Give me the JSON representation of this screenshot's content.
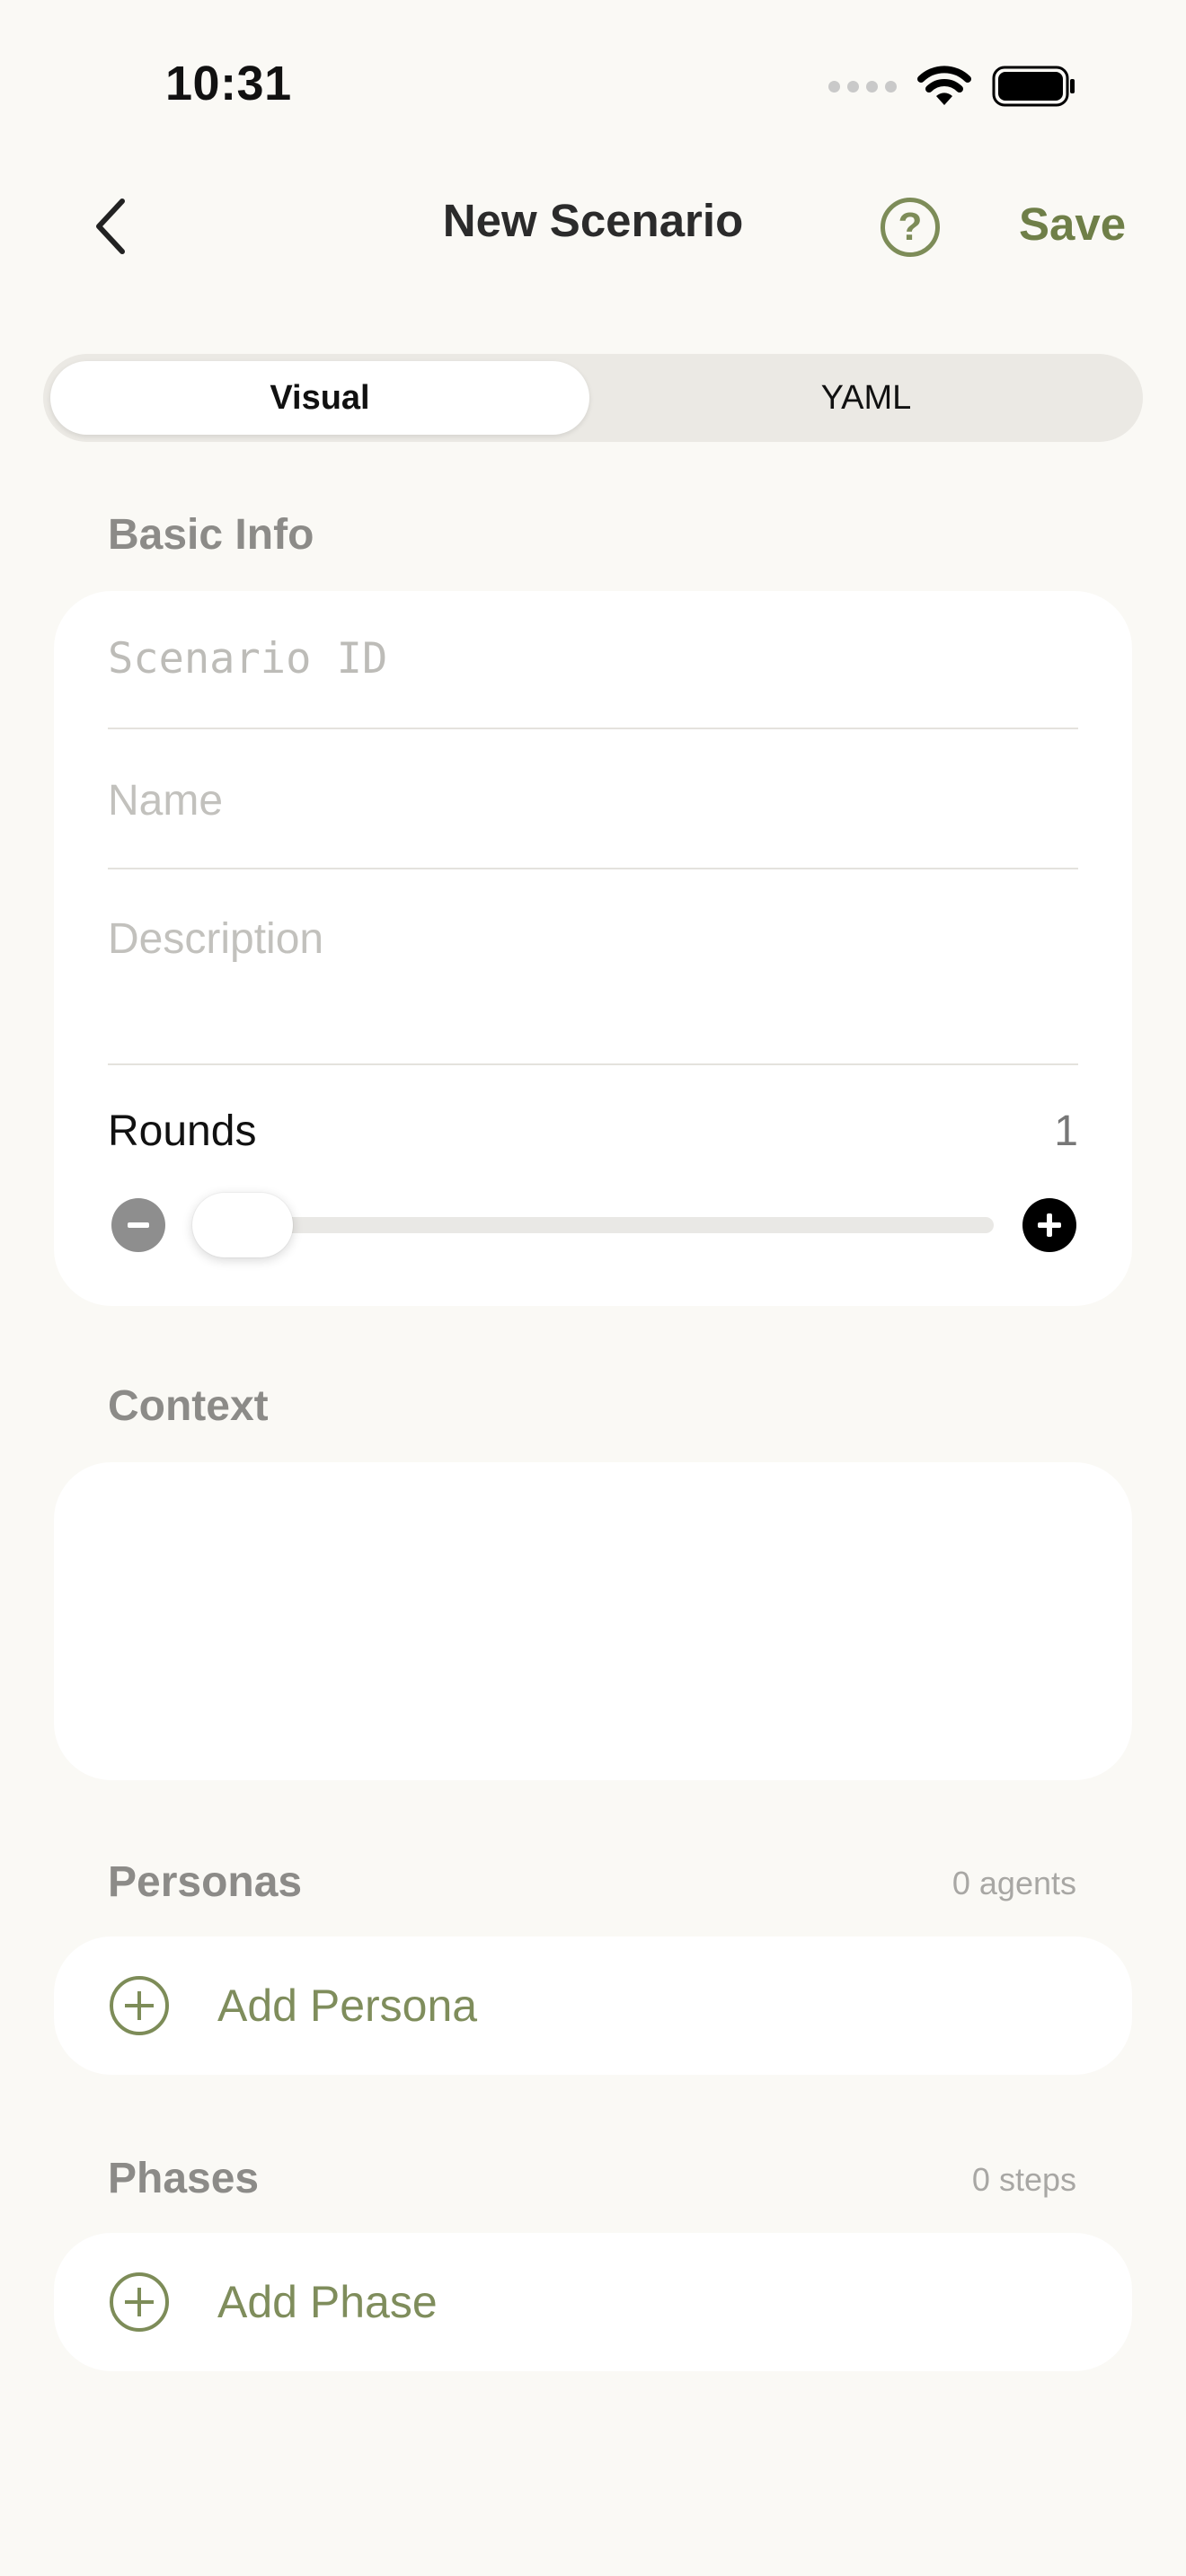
{
  "status_bar": {
    "time": "10:31",
    "icons": [
      "cellular-signal-icon",
      "wifi-icon",
      "battery-icon"
    ]
  },
  "nav": {
    "back_icon": "chevron-left-icon",
    "title": "New Scenario",
    "help_label": "?",
    "save_label": "Save"
  },
  "mode_tabs": {
    "items": [
      {
        "label": "Visual",
        "selected": true
      },
      {
        "label": "YAML",
        "selected": false
      }
    ]
  },
  "basic_info": {
    "header": "Basic Info",
    "scenario_id": {
      "placeholder": "Scenario ID",
      "value": ""
    },
    "name": {
      "placeholder": "Name",
      "value": ""
    },
    "description": {
      "placeholder": "Description",
      "value": ""
    },
    "rounds": {
      "label": "Rounds",
      "value": "1",
      "slider_fraction": 0
    }
  },
  "context": {
    "header": "Context",
    "value": ""
  },
  "personas": {
    "header": "Personas",
    "count_text": "0 agents",
    "add_label": "Add Persona"
  },
  "phases": {
    "header": "Phases",
    "count_text": "0 steps",
    "add_label": "Add Phase"
  },
  "colors": {
    "background": "#faf9f5",
    "card": "#ffffff",
    "accent": "#7d8c58",
    "section_header": "#8c8b88",
    "placeholder": "#c2c1bd"
  }
}
